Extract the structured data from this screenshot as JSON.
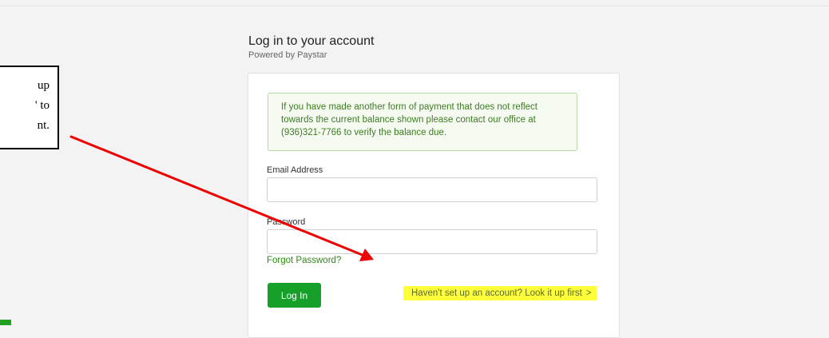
{
  "header": {
    "title": "Log in to your account",
    "subtitle": "Powered by Paystar"
  },
  "notice": {
    "text": "If you have made another form of payment that does not reflect towards the current balance shown please contact our office at (936)321-7766 to verify the balance due."
  },
  "form": {
    "email_label": "Email Address",
    "email_value": "",
    "password_label": "Password",
    "password_value": "",
    "forgot_label": "Forgot Password?",
    "login_label": "Log In",
    "lookup_label": "Haven't set up an account? Look it up first",
    "lookup_chevron": ">"
  },
  "callout": {
    "lines": [
      "up",
      "' to",
      "nt."
    ]
  },
  "colors": {
    "primary_green": "#16a02a",
    "highlight_yellow": "#ffff3a",
    "arrow_red": "#ee0000"
  }
}
